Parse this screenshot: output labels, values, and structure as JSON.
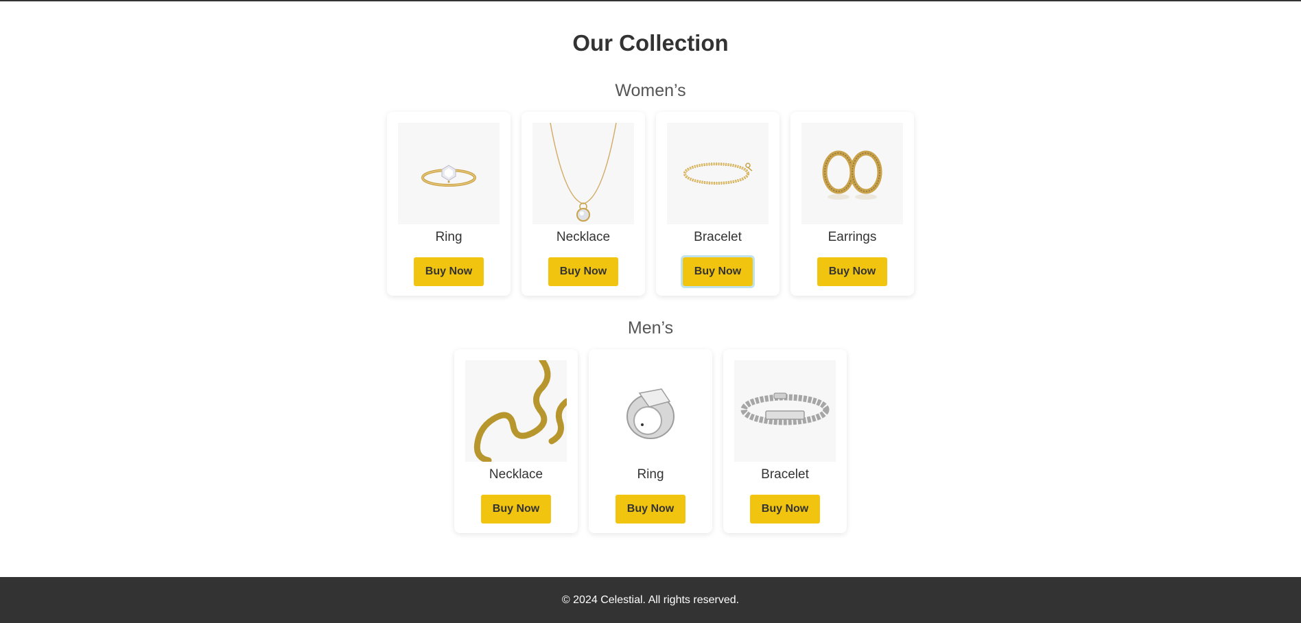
{
  "collection": {
    "title": "Our Collection",
    "womens": {
      "heading": "Women’s",
      "products": [
        {
          "name": "Ring",
          "button": "Buy Now",
          "image": "gold-diamond-ring"
        },
        {
          "name": "Necklace",
          "button": "Buy Now",
          "image": "gold-pendant-necklace"
        },
        {
          "name": "Bracelet",
          "button": "Buy Now",
          "image": "gold-tennis-bracelet"
        },
        {
          "name": "Earrings",
          "button": "Buy Now",
          "image": "gold-hoop-earrings"
        }
      ]
    },
    "mens": {
      "heading": "Men’s",
      "products": [
        {
          "name": "Necklace",
          "button": "Buy Now",
          "image": "gold-cuban-chain"
        },
        {
          "name": "Ring",
          "button": "Buy Now",
          "image": "silver-signet-ring"
        },
        {
          "name": "Bracelet",
          "button": "Buy Now",
          "image": "silver-id-bracelet"
        }
      ]
    }
  },
  "footer": {
    "text": "© 2024 Celestial. All rights reserved."
  },
  "colors": {
    "accent": "#f1c40f",
    "footer_bg": "#333333",
    "text": "#333333"
  }
}
